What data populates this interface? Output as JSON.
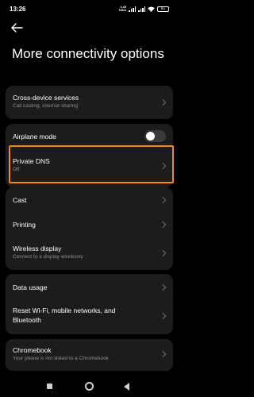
{
  "status_bar": {
    "time": "13:26",
    "speed_top": "1.45",
    "speed_bottom": "KB/s",
    "battery": "81"
  },
  "header": {
    "title": "More connectivity options"
  },
  "sections": {
    "cross_device": {
      "label": "Cross-device services",
      "sub": "Call casting, internet sharing"
    },
    "airplane": {
      "label": "Airplane mode",
      "toggle_on": false
    },
    "private_dns": {
      "label": "Private DNS",
      "sub": "Off"
    },
    "cast": {
      "label": "Cast"
    },
    "printing": {
      "label": "Printing"
    },
    "wireless_display": {
      "label": "Wireless display",
      "sub": "Connect to a display wirelessly"
    },
    "data_usage": {
      "label": "Data usage"
    },
    "reset": {
      "label_line1": "Reset Wi-Fi, mobile networks, and",
      "label_line2": "Bluetooth"
    },
    "chromebook": {
      "label": "Chromebook",
      "sub": "Your phone is not linked to a Chromebook"
    }
  },
  "colors": {
    "background": "#000000",
    "card": "#1c1c1e",
    "highlight": "#f08c1a",
    "secondary_text": "#8e8e93"
  },
  "icons": [
    "back-arrow-icon",
    "chevron-right-icon",
    "signal-icon",
    "wifi-icon",
    "battery-icon"
  ]
}
